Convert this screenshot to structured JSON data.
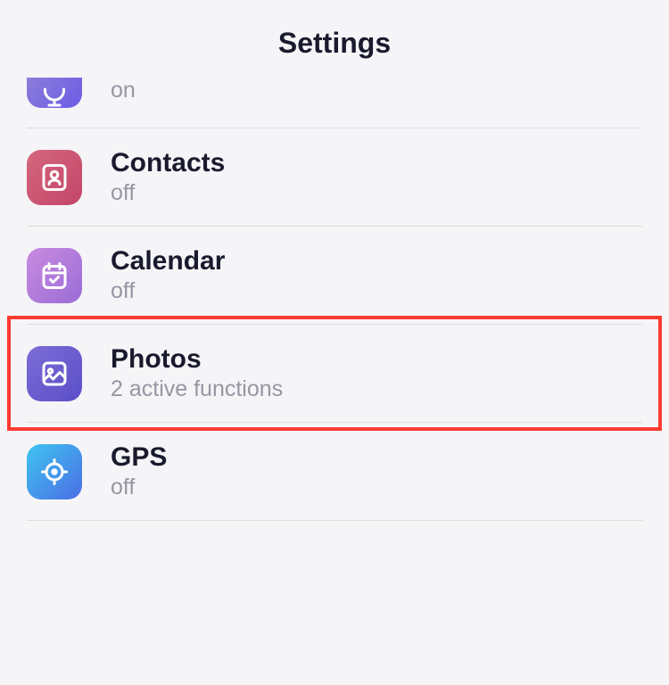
{
  "header": {
    "title": "Settings"
  },
  "rows": [
    {
      "id": "mic",
      "title": "",
      "sub": "on",
      "gradient": "grad-purple1",
      "highlighted": false,
      "partial": true
    },
    {
      "id": "contacts",
      "title": "Contacts",
      "sub": "off",
      "gradient": "grad-red",
      "highlighted": false
    },
    {
      "id": "calendar",
      "title": "Calendar",
      "sub": "off",
      "gradient": "grad-purple2",
      "highlighted": false
    },
    {
      "id": "photos",
      "title": "Photos",
      "sub": "2 active functions",
      "gradient": "grad-purple3",
      "highlighted": true
    },
    {
      "id": "gps",
      "title": "GPS",
      "sub": "off",
      "gradient": "grad-blue",
      "highlighted": false
    }
  ]
}
